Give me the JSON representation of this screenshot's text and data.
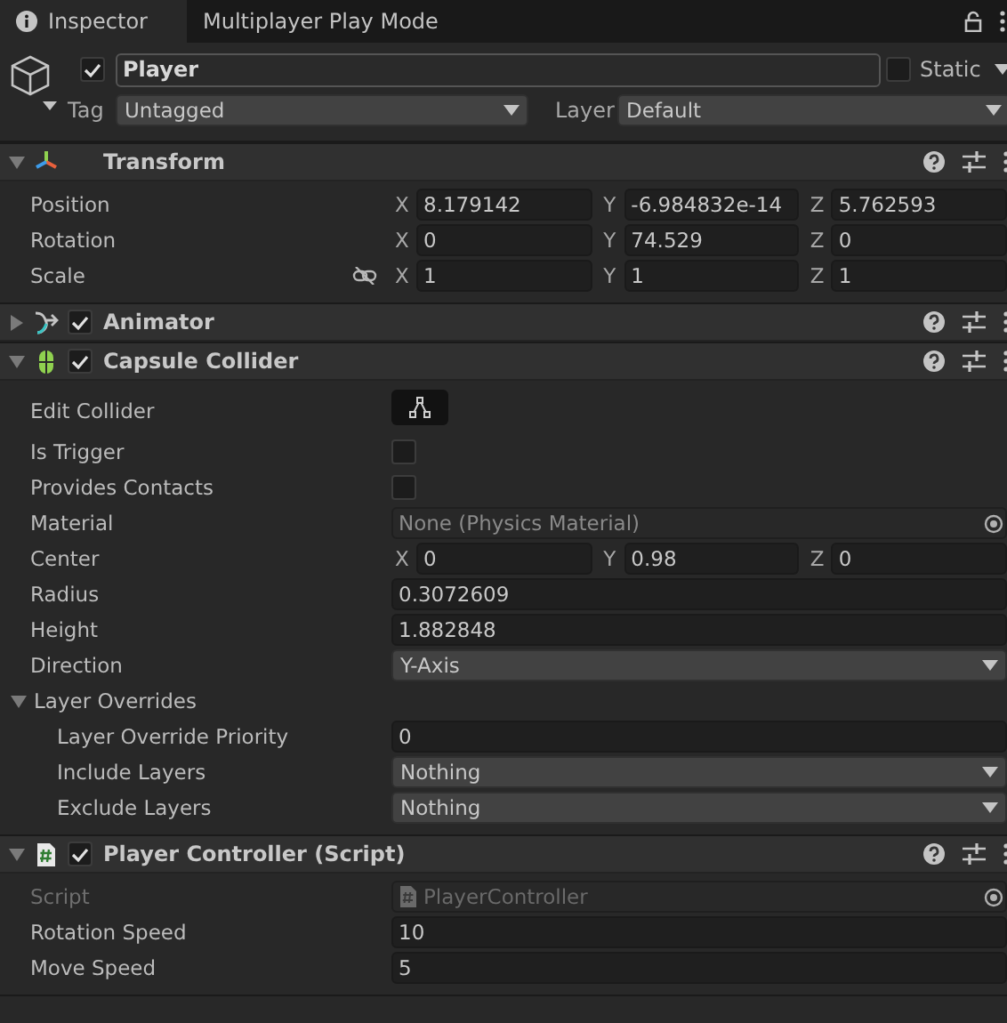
{
  "tabs": [
    {
      "label": "Inspector",
      "selected": true
    },
    {
      "label": "Multiplayer Play Mode",
      "selected": false
    }
  ],
  "object": {
    "active": true,
    "name": "Player",
    "static": false,
    "static_label": "Static",
    "tag_label": "Tag",
    "tag": "Untagged",
    "layer_label": "Layer",
    "layer": "Default"
  },
  "components": [
    {
      "kind": "transform",
      "title": "Transform",
      "expanded": true,
      "properties": [
        {
          "kind": "vector",
          "label": "Position",
          "axes": [
            {
              "axis": "X",
              "value": "8.179142"
            },
            {
              "axis": "Y",
              "value": "-6.984832e-14"
            },
            {
              "axis": "Z",
              "value": "5.762593"
            }
          ]
        },
        {
          "kind": "vector",
          "label": "Rotation",
          "axes": [
            {
              "axis": "X",
              "value": "0"
            },
            {
              "axis": "Y",
              "value": "74.529"
            },
            {
              "axis": "Z",
              "value": "0"
            }
          ]
        },
        {
          "kind": "vector",
          "label": "Scale",
          "proportional": false,
          "axes": [
            {
              "axis": "X",
              "value": "1"
            },
            {
              "axis": "Y",
              "value": "1"
            },
            {
              "axis": "Z",
              "value": "1"
            }
          ]
        }
      ]
    },
    {
      "kind": "animator",
      "title": "Animator",
      "expanded": false,
      "enabled": true
    },
    {
      "kind": "collider",
      "title": "Capsule Collider",
      "expanded": true,
      "enabled": true,
      "properties": [
        {
          "kind": "button",
          "label": "Edit Collider"
        },
        {
          "kind": "checkbox",
          "label": "Is Trigger",
          "checked": false
        },
        {
          "kind": "checkbox",
          "label": "Provides Contacts",
          "checked": false
        },
        {
          "kind": "object",
          "label": "Material",
          "value": "None (Physics Material)"
        },
        {
          "kind": "vector",
          "label": "Center",
          "axes": [
            {
              "axis": "X",
              "value": "0"
            },
            {
              "axis": "Y",
              "value": "0.98"
            },
            {
              "axis": "Z",
              "value": "0"
            }
          ]
        },
        {
          "kind": "text",
          "label": "Radius",
          "value": "0.3072609"
        },
        {
          "kind": "text",
          "label": "Height",
          "value": "1.882848"
        },
        {
          "kind": "dropdown",
          "label": "Direction",
          "value": "Y-Axis"
        },
        {
          "kind": "group",
          "label": "Layer Overrides",
          "expanded": true,
          "children": [
            {
              "kind": "text",
              "label": "Layer Override Priority",
              "value": "0"
            },
            {
              "kind": "dropdown",
              "label": "Include Layers",
              "value": "Nothing"
            },
            {
              "kind": "dropdown",
              "label": "Exclude Layers",
              "value": "Nothing"
            }
          ]
        }
      ]
    },
    {
      "kind": "script",
      "title": "Player Controller (Script)",
      "expanded": true,
      "enabled": true,
      "properties": [
        {
          "kind": "object",
          "label": "Script",
          "value": "PlayerController",
          "disabled": true
        },
        {
          "kind": "text",
          "label": "Rotation Speed",
          "value": "10",
          "disabled": false
        },
        {
          "kind": "text",
          "label": "Move Speed",
          "value": "5",
          "disabled": false
        }
      ]
    }
  ]
}
